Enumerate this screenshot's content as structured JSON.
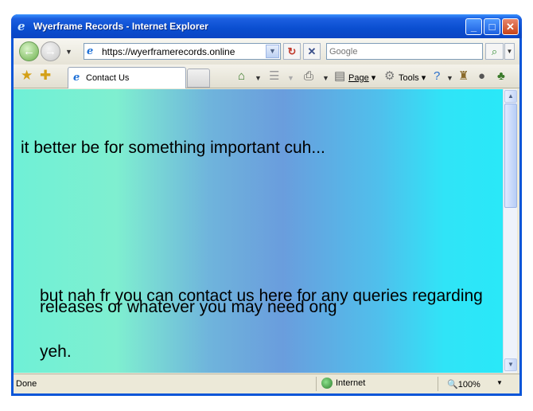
{
  "window": {
    "title": "Wyerframe Records - Internet Explorer",
    "controls": {
      "minimize": "_",
      "maximize": "□",
      "close": "✕"
    }
  },
  "navbar": {
    "back_glyph": "←",
    "forward_glyph": "→",
    "url": "https://wyerframerecords.online",
    "refresh_glyph": "↻",
    "stop_glyph": "✕",
    "search_placeholder": "Google",
    "search_glyph": "⌕"
  },
  "tabs": [
    {
      "label": "Contact Us",
      "active": true
    }
  ],
  "command_bar": {
    "page_label": "Page",
    "tools_label": "Tools"
  },
  "content": {
    "line1": "it better be for something important cuh...",
    "line2": "but nah fr you can contact us here for any queries regarding releases or whatever you may need ong",
    "line3": "yeh."
  },
  "status": {
    "text": "Done",
    "zone": "Internet",
    "zoom": "100%"
  },
  "icons": [
    "ie-logo-icon",
    "back-arrow-icon",
    "forward-arrow-icon",
    "refresh-icon",
    "stop-icon",
    "search-icon",
    "favorites-star-icon",
    "add-favorite-icon",
    "home-icon",
    "feeds-icon",
    "print-icon",
    "page-icon",
    "tools-gear-icon",
    "help-icon",
    "research-icon",
    "messenger-icon",
    "globe-icon",
    "zoom-icon"
  ]
}
